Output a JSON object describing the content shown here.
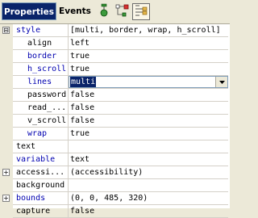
{
  "tabs": [
    {
      "label": "Properties"
    },
    {
      "label": "Events"
    }
  ],
  "toolbar_icons": [
    "filter-icon",
    "subclass-icon",
    "hierarchy-icon"
  ],
  "rows": [
    {
      "name": "style",
      "value": "[multi, border, wrap, h_scroll]",
      "expander": "⊟"
    },
    {
      "name": "align",
      "value": "left"
    },
    {
      "name": "border",
      "value": "true"
    },
    {
      "name": "h_scroll",
      "value": "true"
    },
    {
      "name": "lines",
      "value": "multi"
    },
    {
      "name": "password",
      "value": "false"
    },
    {
      "name": "read_...",
      "value": "false"
    },
    {
      "name": "v_scroll",
      "value": "false"
    },
    {
      "name": "wrap",
      "value": "true"
    },
    {
      "name": "text",
      "value": ""
    },
    {
      "name": "variable",
      "value": "text"
    },
    {
      "name": "accessi...",
      "value": "(accessibility)",
      "expander": "+"
    },
    {
      "name": "background",
      "value": ""
    },
    {
      "name": "bounds",
      "value": "(0, 0, 485, 320)",
      "expander": "+"
    },
    {
      "name": "capture",
      "value": "false"
    }
  ],
  "colors": {
    "selection": "#0a246a",
    "property_blue": "#0000b0",
    "panel": "#ece9d8"
  }
}
